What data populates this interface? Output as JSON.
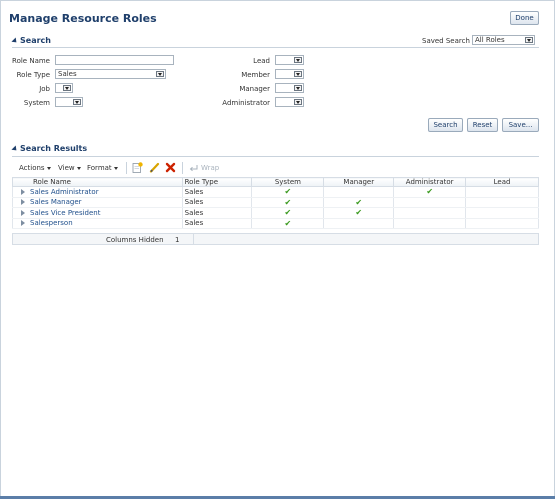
{
  "page": {
    "title": "Manage Resource Roles",
    "done_label": "Done"
  },
  "search": {
    "header": "Search",
    "saved_search_label": "Saved Search",
    "saved_search_value": "All Roles",
    "fields": {
      "role_name_label": "Role Name",
      "role_name_value": "",
      "role_type_label": "Role Type",
      "role_type_value": "Sales",
      "job_label": "Job",
      "system_label": "System",
      "lead_label": "Lead",
      "member_label": "Member",
      "manager_label": "Manager",
      "administrator_label": "Administrator"
    },
    "search_btn": "Search",
    "reset_btn": "Reset",
    "save_btn": "Save..."
  },
  "results": {
    "header": "Search Results",
    "toolbar": {
      "actions": "Actions",
      "view": "View",
      "format": "Format",
      "wrap": "Wrap"
    },
    "columns": [
      "Role Name",
      "Role Type",
      "System",
      "Manager",
      "Administrator",
      "Lead"
    ],
    "rows": [
      {
        "name": "Sales Administrator",
        "type": "Sales",
        "system": true,
        "manager": false,
        "administrator": true,
        "lead": false
      },
      {
        "name": "Sales Manager",
        "type": "Sales",
        "system": true,
        "manager": true,
        "administrator": false,
        "lead": false
      },
      {
        "name": "Sales Vice President",
        "type": "Sales",
        "system": true,
        "manager": true,
        "administrator": false,
        "lead": false
      },
      {
        "name": "Salesperson",
        "type": "Sales",
        "system": true,
        "manager": false,
        "administrator": false,
        "lead": false
      }
    ],
    "check_glyph": "✔",
    "columns_hidden_label": "Columns Hidden",
    "columns_hidden_count": "1"
  },
  "colors": {
    "title": "#1f3f6b",
    "link": "#1f4f8b",
    "check": "#3a9a1f",
    "delete": "#cc2200",
    "edit": "#d9a400"
  }
}
